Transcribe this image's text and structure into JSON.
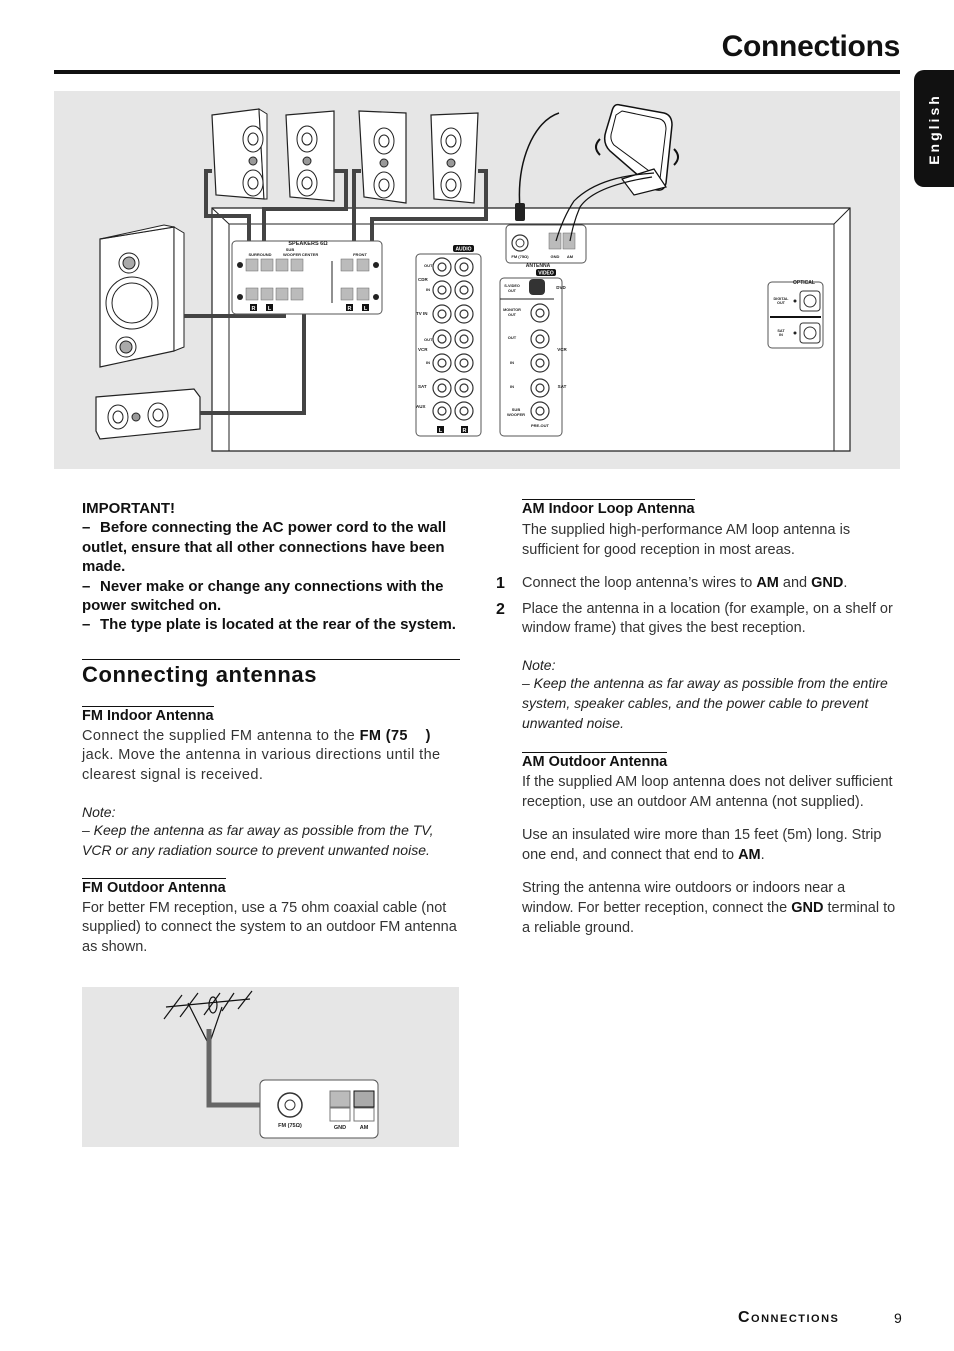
{
  "page": {
    "title": "Connections",
    "language_tab": "English",
    "footer_section": "Connections",
    "page_number": "9"
  },
  "diagram_main": {
    "speakers_label": "SPEAKERS 6Ω",
    "surround_label": "SURROUND",
    "subwoofer_label": "SUB WOOFER",
    "sub_label": "SUB",
    "woofer_label": "WOOFER",
    "center_label": "CENTER",
    "front_label": "FRONT",
    "r_label": "R",
    "l_label": "L",
    "plus": "+",
    "minus": "−",
    "audio_badge": "AUDIO",
    "video_badge": "VIDEO",
    "antenna_label": "ANTENNA",
    "fm_label": "FM (75Ω)",
    "gnd_label": "GND",
    "am_label": "AM",
    "audio_rows": [
      {
        "group": "CDR",
        "sub": "OUT"
      },
      {
        "group": "",
        "sub": "IN"
      },
      {
        "group": "TV IN",
        "sub": ""
      },
      {
        "group": "VCR",
        "sub": "OUT"
      },
      {
        "group": "",
        "sub": "IN"
      },
      {
        "group": "SAT",
        "sub": ""
      },
      {
        "group": "AUX",
        "sub": ""
      }
    ],
    "cdr": "CDR",
    "out": "OUT",
    "in": "IN",
    "tv_in": "TV IN",
    "vcr": "VCR",
    "sat": "SAT",
    "aux": "AUX",
    "svideo_out_1": "S-VIDEO",
    "svideo_out_2": "OUT",
    "dvd": "DVD",
    "monitor_out_1": "MONITOR",
    "monitor_out_2": "OUT",
    "sub_woofer_1": "SUB",
    "sub_woofer_2": "WOOFER",
    "pre_out": "PRE-OUT",
    "optical_label": "OPTICAL",
    "digital_out_1": "DIGITAL",
    "digital_out_2": "OUT",
    "sat_in_1": "SAT",
    "sat_in_2": "IN"
  },
  "important": {
    "heading": "IMPORTANT!",
    "items": [
      "Before connecting the AC power cord to the wall outlet, ensure that all other connections have been made.",
      "Never make or change any connections with the power switched on.",
      "The type plate is located at the rear of the system."
    ],
    "dash": "–"
  },
  "connecting_antennas": {
    "heading": "Connecting antennas",
    "fm_indoor": {
      "heading": "FM Indoor Antenna",
      "text_before": "Connect the supplied FM antenna to the ",
      "text_bold": "FM (75    )",
      "text_after": " jack. Move the antenna in various directions until the clearest signal is received.",
      "note_label": "Note:",
      "note_text": "–  Keep the antenna as far away as possible from the TV, VCR or any radiation source to prevent unwanted noise."
    },
    "fm_outdoor": {
      "heading": "FM Outdoor Antenna",
      "text": "For better FM reception, use a 75 ohm coaxial cable (not supplied) to connect the system to an outdoor FM antenna as shown."
    },
    "fm_diagram": {
      "fm_label": "FM (75Ω)",
      "gnd_label": "GND",
      "am_label": "AM"
    }
  },
  "am_indoor": {
    "heading": "AM Indoor Loop Antenna",
    "intro": "The supplied high-performance AM loop antenna is sufficient for good reception in most areas.",
    "steps": [
      {
        "num": "1",
        "before": "Connect the loop antenna’s wires to ",
        "b1": "AM",
        "mid": " and ",
        "b2": "GND",
        "after": "."
      },
      {
        "num": "2",
        "text": "Place the antenna in a location (for example, on a shelf or window frame) that gives the best reception."
      }
    ],
    "note_label": "Note:",
    "note_text": "–  Keep the antenna as far away as possible from the entire system, speaker cables, and the power cable to prevent unwanted noise."
  },
  "am_outdoor": {
    "heading": "AM Outdoor Antenna",
    "p1": "If the supplied AM loop antenna does not deliver sufficient reception, use an outdoor AM antenna (not supplied).",
    "p2_before": "Use an insulated wire more than 15 feet (5m) long. Strip one end, and connect that end to ",
    "p2_bold": "AM",
    "p2_after": ".",
    "p3_before": "String the antenna wire outdoors or indoors near a window. For better reception, connect the ",
    "p3_bold": "GND",
    "p3_after": " terminal to a reliable ground."
  }
}
